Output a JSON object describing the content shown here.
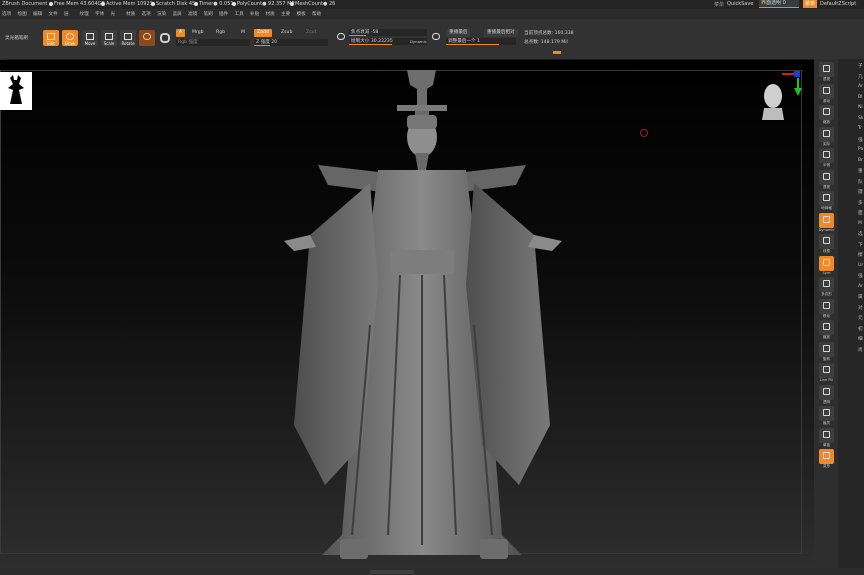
{
  "titlebar": {
    "app": "ZBrush Document",
    "free_mem": "Free Mem 43.604GB",
    "active_mem": "Active Mem 10923",
    "scratch": "Scratch Disk 45",
    "timer": "Timer● 0.051",
    "polycount": "PolyCount● 92.357 MP",
    "meshcount": "MeshCount● 26",
    "quicksave_hint": "菜单",
    "quicksave": "QuickSave",
    "transparency": "界面透明 0",
    "menu_btn": "菜单",
    "script": "DefaultZScript"
  },
  "menus": [
    "选项",
    "绘图",
    "编辑",
    "文件",
    "层",
    "纹理",
    "字体",
    "光",
    "材质",
    "选项",
    "渲染",
    "蓝屏",
    "滤镜",
    "笔刷",
    "插件",
    "工具",
    "补贴",
    "材质",
    "主要",
    "模板",
    "帮助"
  ],
  "toolbar": {
    "lightbox": "灵光箱笔刷",
    "edit": "Edit",
    "draw": "Draw",
    "move": "Move",
    "scale": "Scale",
    "rotate": "Rotate",
    "a": "A",
    "mrgb": "Mrgb",
    "rgb": "Rgb",
    "m": "M",
    "rgb_intensity": "Rgb 强度",
    "zadd": "Zadd",
    "zsub": "Zsub",
    "zcut": "Zcut",
    "z_intensity": "Z 强度 20",
    "focal_shift": "焦点衰减 -58",
    "draw_size": "绘制大小 30.22235",
    "dynamic": "Dynamic",
    "replay_last": "重播最后",
    "replay_last_rel": "重播最后相对",
    "adjust_last": "调整最后一个 1",
    "active_points": "当前顶点总数: 160,338",
    "total_points": "总点数: 148.179 Mil"
  },
  "shelf": [
    {
      "label": "透视"
    },
    {
      "label": "滚动"
    },
    {
      "label": "缩放"
    },
    {
      "label": "实际"
    },
    {
      "label": "半侧"
    },
    {
      "label": "透视"
    },
    {
      "label": "地网格"
    },
    {
      "label": "Dynamic"
    },
    {
      "label": "线框"
    },
    {
      "label": "Sym"
    },
    {
      "label": "多边形"
    },
    {
      "label": "移动"
    },
    {
      "label": "缩放"
    },
    {
      "label": "旋转"
    },
    {
      "label": "Line Fill"
    },
    {
      "label": "透明"
    },
    {
      "label": "幽灵"
    },
    {
      "label": "单独"
    },
    {
      "label": "变形"
    }
  ],
  "tray_text": [
    "子",
    "几",
    "Ar",
    "Bl",
    "Ni",
    "Sk",
    "Tr",
    "强",
    "Pa",
    "Br",
    "重",
    "队",
    "键",
    "多",
    "面",
    "M",
    "选",
    "下",
    "擦",
    "Ur",
    "强",
    "Ar",
    "属",
    "对",
    "元",
    "初",
    "细",
    "尚"
  ],
  "colors": {
    "accent": "#f08a24",
    "bg": "#2a2a2a"
  }
}
